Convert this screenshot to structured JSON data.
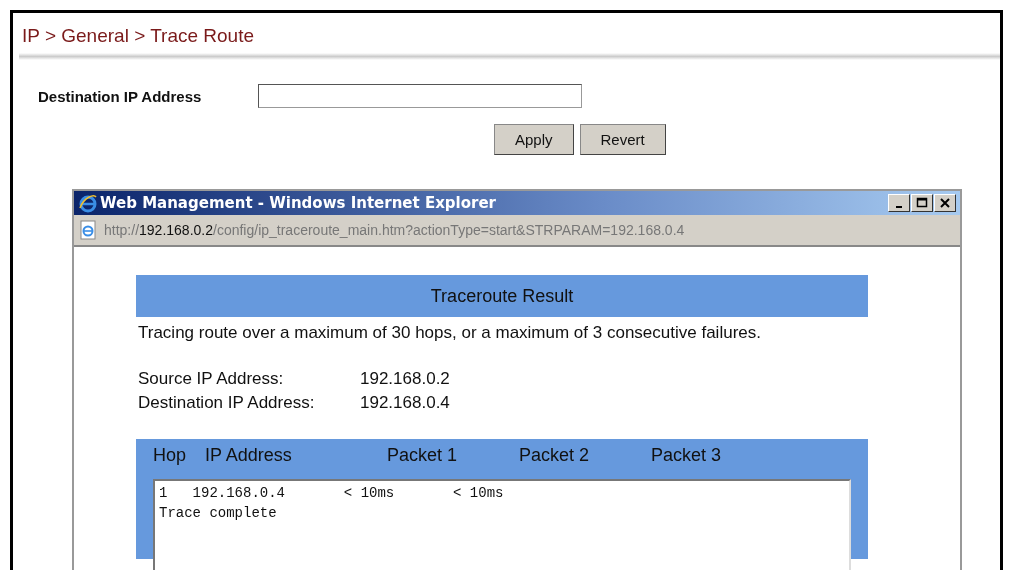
{
  "breadcrumb": "IP > General > Trace Route",
  "form": {
    "label": "Destination IP Address"
  },
  "buttons": [
    "Apply",
    "Revert"
  ],
  "popup": {
    "title": "Web Management - Windows Internet Explorer",
    "url": {
      "scheme": "http://",
      "host": "192.168.0.2",
      "path": "/config/ip_traceroute_main.htm?actionType=start&STRPARAM=192.168.0.4"
    },
    "heading": "Traceroute Result",
    "note": "Tracing route over a maximum of 30 hops, or a maximum of 3 consecutive failures.",
    "info": [
      {
        "label": "Source IP Address:",
        "value": "192.168.0.2"
      },
      {
        "label": "Destination IP Address:",
        "value": "192.168.0.4"
      }
    ],
    "columns": [
      "Hop",
      "IP Address",
      "Packet 1",
      "Packet 2",
      "Packet 3"
    ],
    "output": [
      "1   192.168.0.4       < 10ms       < 10ms",
      "Trace complete"
    ]
  }
}
